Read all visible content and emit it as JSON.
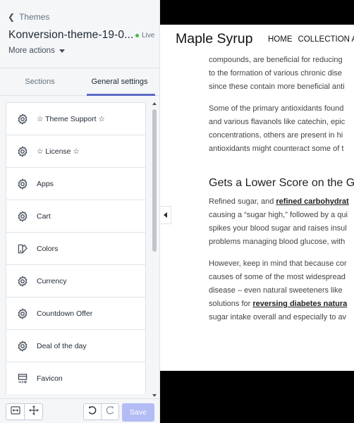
{
  "sidebar": {
    "back_label": "Themes",
    "theme_name": "Konversion-theme-19-0...",
    "live_label": "Live",
    "more_actions_label": "More actions",
    "tabs": [
      {
        "label": "Sections",
        "active": false
      },
      {
        "label": "General settings",
        "active": true
      }
    ],
    "items": [
      {
        "label": "☆ Theme Support ☆",
        "icon": "gear-icon"
      },
      {
        "label": "☆ License ☆",
        "icon": "gear-icon"
      },
      {
        "label": "Apps",
        "icon": "gear-icon"
      },
      {
        "label": "Cart",
        "icon": "gear-icon"
      },
      {
        "label": "Colors",
        "icon": "paint-bucket-icon"
      },
      {
        "label": "Currency",
        "icon": "gear-icon"
      },
      {
        "label": "Countdown Offer",
        "icon": "gear-icon"
      },
      {
        "label": "Deal of the day",
        "icon": "gear-icon"
      },
      {
        "label": "Favicon",
        "icon": "favicon-icon"
      }
    ],
    "footer": {
      "save_label": "Save"
    }
  },
  "preview": {
    "site_title": "Maple Syrup",
    "nav": [
      "HOME",
      "COLLECTION A"
    ],
    "para1": [
      "compounds, are beneficial for reducing",
      "to the formation of various chronic dise",
      "since these contain more beneficial anti"
    ],
    "para2": [
      "Some of the primary antioxidants found",
      "and various flavanols like catechin, epic",
      "concentrations, others are present in hi",
      "antioxidants might counteract some of t"
    ],
    "heading": "Gets a Lower Score on the G",
    "para3": {
      "line1_pre": "Refined sugar, and ",
      "line1_link": "refined carbohydrat",
      "lines": [
        "causing a “sugar high,” followed by a qui",
        "spikes your blood sugar and raises insul",
        "problems managing blood glucose, with"
      ]
    },
    "para4": {
      "lines": [
        "However, keep in mind that because cor",
        "causes of some of the most widespread",
        "disease – even natural sweeteners like"
      ],
      "line4_pre": "solutions for ",
      "line4_link": "reversing diabetes natura",
      "line5": "sugar intake overall and especially to av"
    }
  },
  "colors": {
    "accent": "#5c6ac4",
    "save_disabled": "#b3bcf5",
    "live": "#50b83c"
  }
}
